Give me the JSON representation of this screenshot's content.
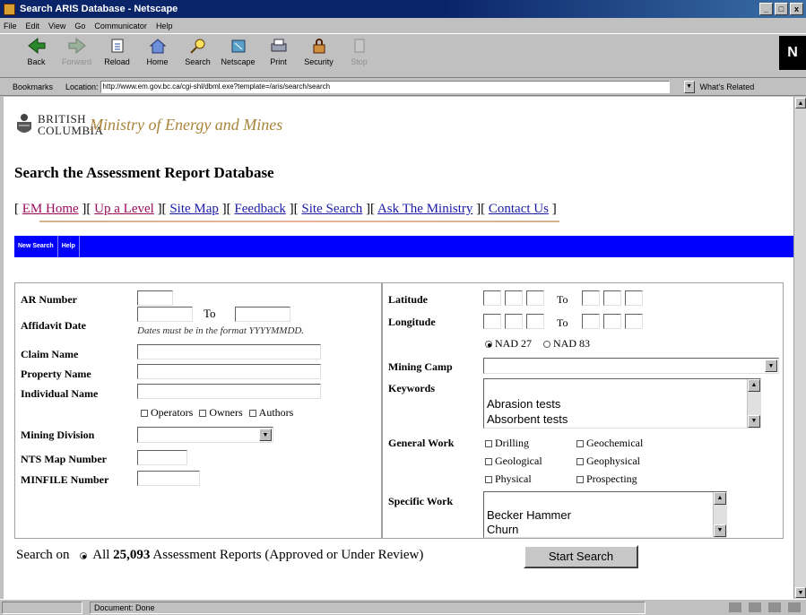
{
  "window": {
    "title": "Search ARIS Database - Netscape",
    "min": "_",
    "max": "□",
    "close": "x"
  },
  "menu": [
    "File",
    "Edit",
    "View",
    "Go",
    "Communicator",
    "Help"
  ],
  "toolbar": {
    "buttons": [
      {
        "label": "Back",
        "icon": "back-arrow-icon"
      },
      {
        "label": "Forward",
        "icon": "forward-arrow-icon"
      },
      {
        "label": "Reload",
        "icon": "reload-icon"
      },
      {
        "label": "Home",
        "icon": "home-icon"
      },
      {
        "label": "Search",
        "icon": "search-icon"
      },
      {
        "label": "Netscape",
        "icon": "netscape-icon"
      },
      {
        "label": "Print",
        "icon": "print-icon"
      },
      {
        "label": "Security",
        "icon": "security-lock-icon"
      },
      {
        "label": "Stop",
        "icon": "stop-icon"
      }
    ],
    "logo": "N"
  },
  "location": {
    "bookmarks": "Bookmarks",
    "label": "Location:",
    "url": "http://www.em.gov.bc.ca/cgi-shl/dbml.exe?template=/aris/search/search",
    "whats_related": "What's Related"
  },
  "header": {
    "province_line1": "BRITISH",
    "province_line2": "COLUMBIA",
    "ministry": "Ministry of Energy and Mines",
    "page_title": "Search the Assessment Report Database"
  },
  "nav": {
    "links": [
      "EM Home",
      "Up a Level",
      "Site Map",
      "Feedback",
      "Site Search",
      "Ask The Ministry",
      "Contact Us"
    ]
  },
  "bluebar": {
    "new_search": "New Search",
    "help": "Help"
  },
  "left": {
    "ar_number": "AR Number",
    "affidavit_date": "Affidavit Date",
    "to": "To",
    "date_hint": "Dates must be in the format YYYYMMDD.",
    "claim_name": "Claim Name",
    "property_name": "Property Name",
    "individual_name": "Individual Name",
    "operators": "Operators",
    "owners": "Owners",
    "authors": "Authors",
    "mining_division": "Mining Division",
    "nts_map": "NTS Map Number",
    "minfile": "MINFILE Number"
  },
  "right": {
    "latitude": "Latitude",
    "longitude": "Longitude",
    "to": "To",
    "nad27": "NAD 27",
    "nad83": "NAD 83",
    "mining_camp": "Mining Camp",
    "keywords": "Keywords",
    "keyword_options": [
      "Abrasion tests",
      "Absorbent tests"
    ],
    "general_work": "General Work",
    "gw_options": [
      "Drilling",
      "Geochemical",
      "Geological",
      "Geophysical",
      "Physical",
      "Prospecting"
    ],
    "specific_work": "Specific Work",
    "specific_options": [
      "Becker Hammer",
      "Churn"
    ]
  },
  "search": {
    "prefix": "Search on",
    "all": "All",
    "count": "25,093",
    "suffix": "Assessment Reports (Approved or Under Review)",
    "button": "Start Search"
  },
  "status": {
    "text": "Document: Done"
  }
}
